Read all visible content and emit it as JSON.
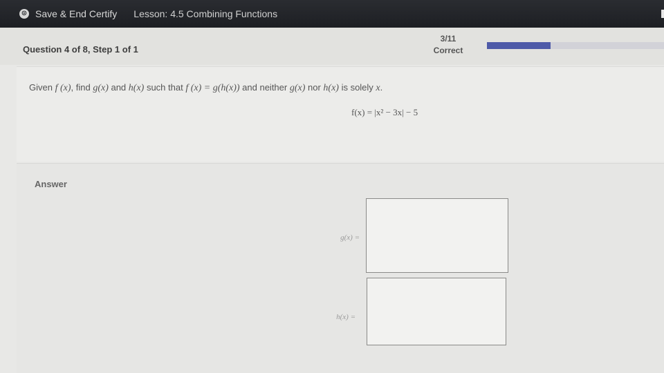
{
  "topbar": {
    "save_label": "Save & End Certify",
    "lesson_label": "Lesson: 4.5 Combining Functions"
  },
  "question": {
    "title": "Question 4 of 8, Step 1 of 1",
    "score_fraction": "3/11",
    "score_status": "Correct",
    "progress_fraction": 0.36
  },
  "prompt": {
    "p1": "Given ",
    "f": "f (x)",
    "p2": ", find ",
    "g": "g(x)",
    "p3": " and ",
    "h": "h(x)",
    "p4": " such that ",
    "eq": "f (x)  =  g(h(x))",
    "p5": " and neither ",
    "g2": "g(x)",
    "p6": " nor ",
    "h2": "h(x)",
    "p7": " is solely ",
    "x": "x",
    "p8": "."
  },
  "formula": "f(x) = |x² − 3x| − 5",
  "answer": {
    "label": "Answer",
    "g_label": "g(x) =",
    "h_label": "h(x) ="
  }
}
